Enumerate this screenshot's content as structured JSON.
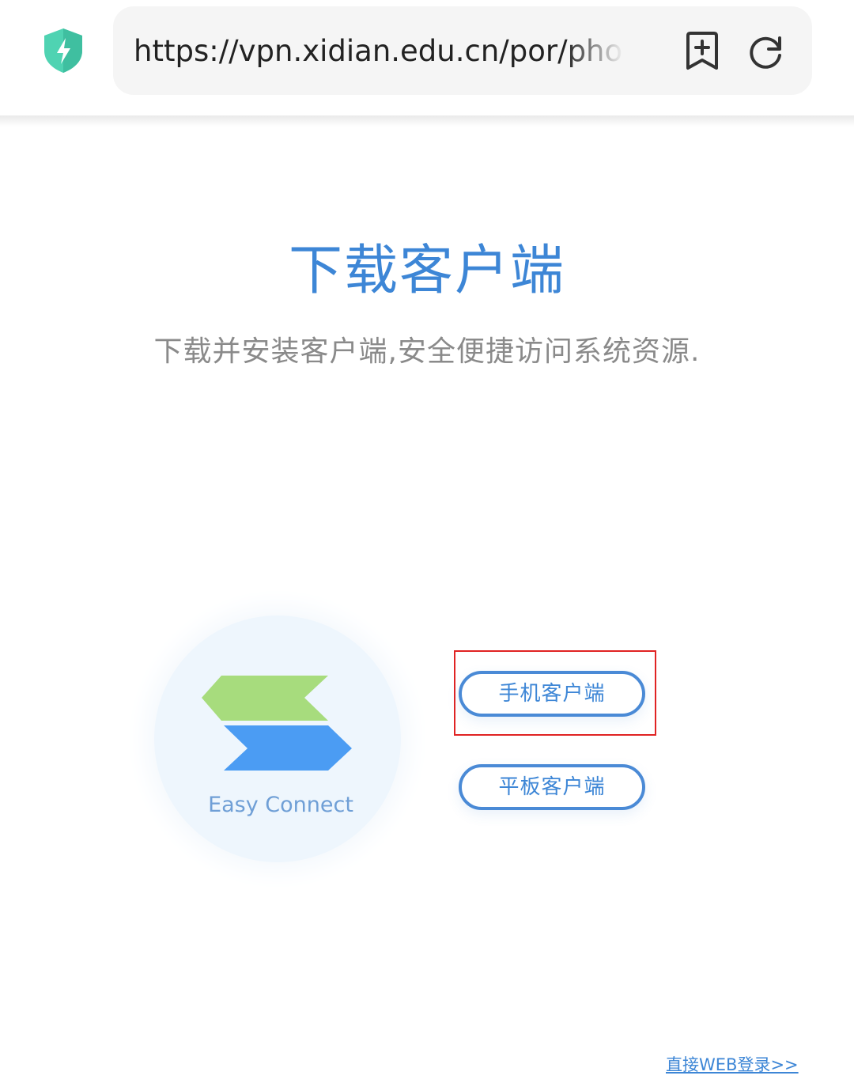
{
  "browser": {
    "url": "https://vpn.xidian.edu.cn/por/phone_index.csp",
    "security_icon": "shield-lightning-icon",
    "bookmark_icon": "bookmark-add-icon",
    "reload_icon": "reload-icon"
  },
  "content": {
    "title": "下载客户端",
    "subtitle": "下载并安装客户端,安全便捷访问系统资源."
  },
  "logo": {
    "name": "Easy Connect",
    "colors": {
      "top_arrow": "#a7dc7d",
      "bottom_arrow": "#4b9cf3"
    }
  },
  "buttons": {
    "phone_client": "手机客户端",
    "tablet_client": "平板客户端"
  },
  "links": {
    "web_login": "直接WEB登录>>"
  },
  "colors": {
    "accent": "#3d86d6",
    "highlight_box": "#e02323"
  }
}
